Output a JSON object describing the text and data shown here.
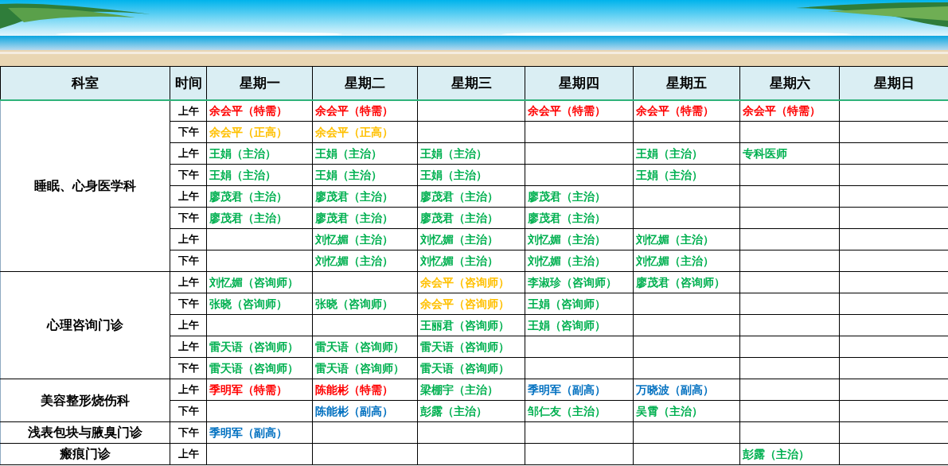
{
  "table": {
    "columns": [
      "科室",
      "时间",
      "星期一",
      "星期二",
      "星期三",
      "星期四",
      "星期五",
      "星期六",
      "星期日"
    ],
    "departments": [
      {
        "name": "睡眠、心身医学科",
        "rows": [
          {
            "time": "上午",
            "mon": {
              "text": "余会平（特需）",
              "color": "#ff0000"
            },
            "tue": {
              "text": "余会平（特需）",
              "color": "#ff0000"
            },
            "thu": {
              "text": "余会平（特需）",
              "color": "#ff0000"
            },
            "fri": {
              "text": "余会平（特需）",
              "color": "#ff0000"
            },
            "sat": {
              "text": "余会平（特需）",
              "color": "#ff0000"
            }
          },
          {
            "time": "下午",
            "mon": {
              "text": "余会平（正高）",
              "color": "#ffc000"
            },
            "tue": {
              "text": "余会平（正高）",
              "color": "#ffc000"
            }
          },
          {
            "time": "上午",
            "mon": {
              "text": "王娟（主治）",
              "color": "#00b050"
            },
            "tue": {
              "text": "王娟（主治）",
              "color": "#00b050"
            },
            "wed": {
              "text": "王娟（主治）",
              "color": "#00b050"
            },
            "fri": {
              "text": "王娟（主治）",
              "color": "#00b050"
            },
            "sat": {
              "text": "专科医师",
              "color": "#00b050"
            }
          },
          {
            "time": "下午",
            "mon": {
              "text": "王娟（主治）",
              "color": "#00b050"
            },
            "tue": {
              "text": "王娟（主治）",
              "color": "#00b050"
            },
            "wed": {
              "text": "王娟（主治）",
              "color": "#00b050"
            },
            "fri": {
              "text": "王娟（主治）",
              "color": "#00b050"
            }
          },
          {
            "time": "上午",
            "mon": {
              "text": "廖茂君（主治）",
              "color": "#00b050"
            },
            "tue": {
              "text": "廖茂君（主治）",
              "color": "#00b050"
            },
            "wed": {
              "text": "廖茂君（主治）",
              "color": "#00b050"
            },
            "thu": {
              "text": "廖茂君（主治）",
              "color": "#00b050"
            }
          },
          {
            "time": "下午",
            "mon": {
              "text": "廖茂君（主治）",
              "color": "#00b050"
            },
            "tue": {
              "text": "廖茂君（主治）",
              "color": "#00b050"
            },
            "wed": {
              "text": "廖茂君（主治）",
              "color": "#00b050"
            },
            "thu": {
              "text": "廖茂君（主治）",
              "color": "#00b050"
            }
          },
          {
            "time": "上午",
            "tue": {
              "text": "刘忆媚（主治）",
              "color": "#00b050"
            },
            "wed": {
              "text": "刘忆媚（主治）",
              "color": "#00b050"
            },
            "thu": {
              "text": "刘忆媚（主治）",
              "color": "#00b050"
            },
            "fri": {
              "text": "刘忆媚（主治）",
              "color": "#00b050"
            }
          },
          {
            "time": "下午",
            "tue": {
              "text": "刘忆媚（主治）",
              "color": "#00b050"
            },
            "wed": {
              "text": "刘忆媚（主治）",
              "color": "#00b050"
            },
            "thu": {
              "text": "刘忆媚（主治）",
              "color": "#00b050"
            },
            "fri": {
              "text": "刘忆媚（主治）",
              "color": "#00b050"
            }
          }
        ]
      },
      {
        "name": "心理咨询门诊",
        "rows": [
          {
            "time": "上午",
            "mon": {
              "text": "刘忆媚（咨询师）",
              "color": "#00b050"
            },
            "wed": {
              "text": "余会平（咨询师）",
              "color": "#ffc000"
            },
            "thu": {
              "text": "李淑珍（咨询师）",
              "color": "#00b050"
            },
            "fri": {
              "text": "廖茂君（咨询师）",
              "color": "#00b050"
            }
          },
          {
            "time": "下午",
            "mon": {
              "text": "张晓（咨询师）",
              "color": "#00b050"
            },
            "tue": {
              "text": "张晓（咨询师）",
              "color": "#00b050"
            },
            "wed": {
              "text": "余会平（咨询师）",
              "color": "#ffc000"
            },
            "thu": {
              "text": "王娟（咨询师）",
              "color": "#00b050"
            }
          },
          {
            "time": "上午",
            "wed": {
              "text": "王丽君（咨询师）",
              "color": "#00b050"
            },
            "thu": {
              "text": "王娟（咨询师）",
              "color": "#00b050"
            }
          },
          {
            "time": "上午",
            "mon": {
              "text": "雷天语（咨询师）",
              "color": "#00b050"
            },
            "tue": {
              "text": "雷天语（咨询师）",
              "color": "#00b050"
            },
            "wed": {
              "text": "雷天语（咨询师）",
              "color": "#00b050"
            }
          },
          {
            "time": "下午",
            "mon": {
              "text": "雷天语（咨询师）",
              "color": "#00b050"
            },
            "tue": {
              "text": "雷天语（咨询师）",
              "color": "#00b050"
            },
            "wed": {
              "text": "雷天语（咨询师）",
              "color": "#00b050"
            }
          }
        ]
      },
      {
        "name": "美容整形烧伤科",
        "rows": [
          {
            "time": "上午",
            "mon": {
              "text": "季明军（特需）",
              "color": "#ff0000"
            },
            "tue": {
              "text": "陈能彬（特需）",
              "color": "#ff0000"
            },
            "wed": {
              "text": "梁棚宇（主治）",
              "color": "#00b050"
            },
            "thu": {
              "text": "季明军（副高）",
              "color": "#0070c0"
            },
            "fri": {
              "text": "万晓波（副高）",
              "color": "#0070c0"
            }
          },
          {
            "time": "下午",
            "tue": {
              "text": "陈能彬（副高）",
              "color": "#0070c0"
            },
            "wed": {
              "text": "彭露（主治）",
              "color": "#00b050"
            },
            "thu": {
              "text": "邹仁友（主治）",
              "color": "#00b050"
            },
            "fri": {
              "text": "吴霄（主治）",
              "color": "#00b050"
            }
          }
        ]
      },
      {
        "name": "浅表包块与腋臭门诊",
        "rows": [
          {
            "time": "下午",
            "mon": {
              "text": "季明军（副高）",
              "color": "#0070c0"
            }
          }
        ]
      },
      {
        "name": "瘢痕门诊",
        "rows": [
          {
            "time": "上午",
            "sat": {
              "text": "彭露（主治）",
              "color": "#00b050"
            }
          }
        ]
      }
    ]
  }
}
